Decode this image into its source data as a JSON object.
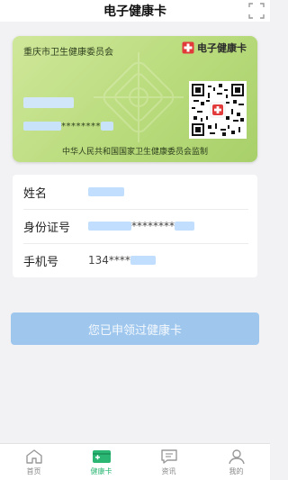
{
  "header": {
    "title": "电子健康卡",
    "scan_icon": "scan-frame-icon"
  },
  "card": {
    "issuer": "重庆市卫生健康委员会",
    "brand_label": "电子健康卡",
    "brand_icon": "red-cross-icon",
    "id_masked_middle": "********",
    "supervisor": "中华人民共和国国家卫生健康委员会监制",
    "background_color": "#b9db7c"
  },
  "info": {
    "name_label": "姓名",
    "id_label": "身份证号",
    "id_masked_middle": "********",
    "phone_label": "手机号",
    "phone_prefix": "134****"
  },
  "apply_button": {
    "label": "您已申领过健康卡",
    "color": "#9fc7ee"
  },
  "tabbar": {
    "active_color": "#2bb673",
    "tabs": [
      {
        "label": "首页",
        "icon": "home-icon"
      },
      {
        "label": "健康卡",
        "icon": "health-card-icon"
      },
      {
        "label": "资讯",
        "icon": "news-icon"
      },
      {
        "label": "我的",
        "icon": "profile-icon"
      }
    ]
  }
}
